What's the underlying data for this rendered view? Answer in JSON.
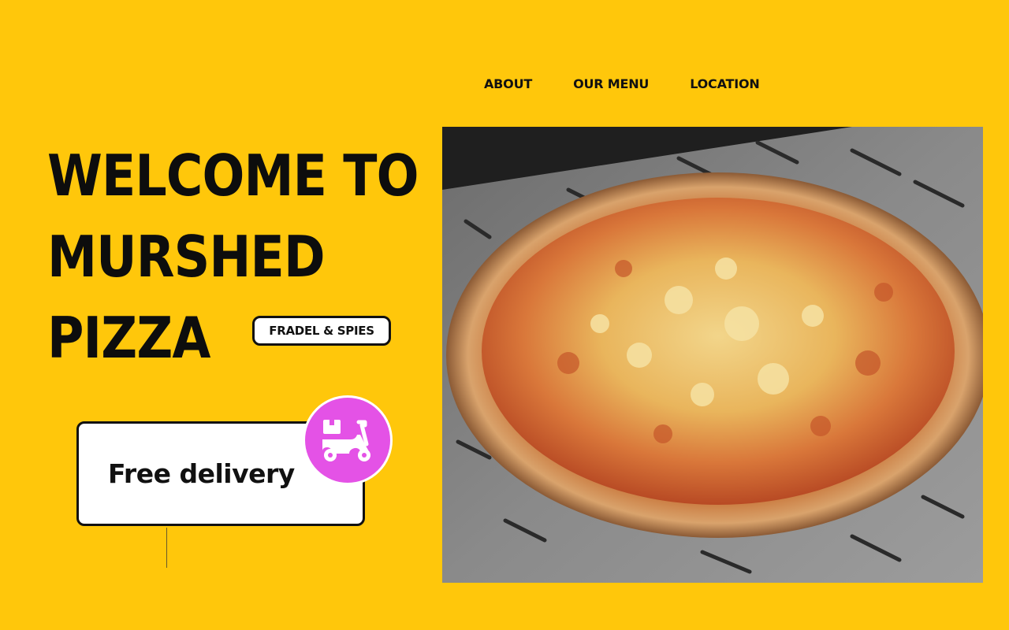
{
  "nav": {
    "items": [
      {
        "label": "ABOUT"
      },
      {
        "label": "OUR MENU"
      },
      {
        "label": "LOCATION"
      }
    ]
  },
  "hero": {
    "title_lines": [
      "WELCOME TO",
      "MURSHED",
      "PIZZA"
    ],
    "tag": "FRADEL & SPIES"
  },
  "delivery": {
    "label": "Free delivery",
    "icon": "delivery-scooter-icon"
  },
  "colors": {
    "background": "#FFC70B",
    "badge": "#E452E6",
    "text": "#111111"
  },
  "image": {
    "subject": "pizza-photo"
  }
}
